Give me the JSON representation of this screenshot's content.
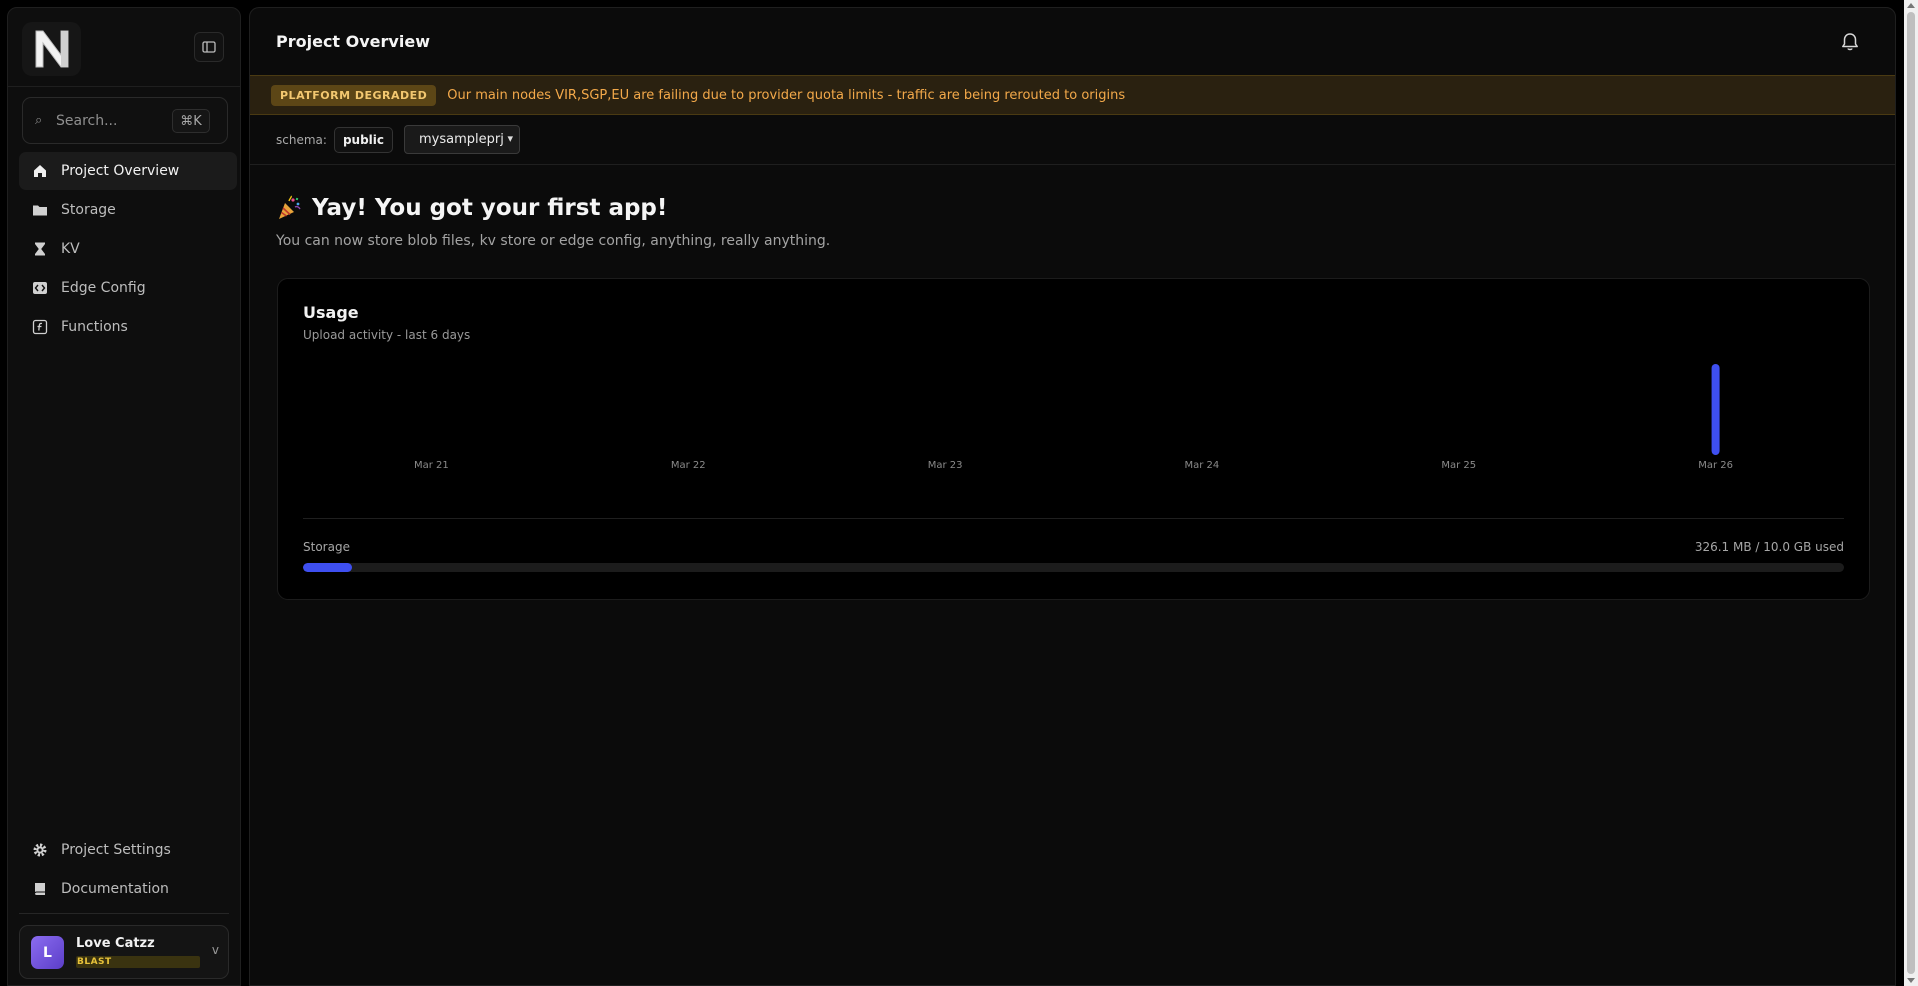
{
  "sidebar": {
    "logo_letter": "N",
    "search": {
      "placeholder": "Search...",
      "shortcut": "⌘K"
    },
    "nav": [
      {
        "label": "Project Overview",
        "icon": "home-icon",
        "active": true
      },
      {
        "label": "Storage",
        "icon": "folder-icon",
        "active": false
      },
      {
        "label": "KV",
        "icon": "hourglass-icon",
        "active": false
      },
      {
        "label": "Edge Config",
        "icon": "code-icon",
        "active": false
      },
      {
        "label": "Functions",
        "icon": "function-icon",
        "active": false
      }
    ],
    "bottom_nav": [
      {
        "label": "Project Settings",
        "icon": "gear-icon"
      },
      {
        "label": "Documentation",
        "icon": "book-icon"
      }
    ],
    "user": {
      "initial": "L",
      "name": "Love Catzz",
      "plan": "BLAST",
      "chevron": "v"
    }
  },
  "header": {
    "title": "Project Overview"
  },
  "banner": {
    "badge": "PLATFORM DEGRADED",
    "message": "Our main nodes VIR,SGP,EU are failing due to provider quota limits - traffic are being rerouted to origins"
  },
  "schema": {
    "label": "schema:",
    "value": "public",
    "project": "mysampleprj"
  },
  "hero": {
    "title": "Yay! You got your first app!",
    "subtitle": "You can now store blob files, kv store or edge config, anything, really anything."
  },
  "usage": {
    "title": "Usage",
    "subtitle": "Upload activity - last 6 days",
    "storage_label": "Storage",
    "storage_value": "326.1 MB / 10.0 GB used",
    "storage_fraction": 0.032
  },
  "chart_data": {
    "type": "bar",
    "categories": [
      "Mar 21",
      "Mar 22",
      "Mar 23",
      "Mar 24",
      "Mar 25",
      "Mar 26"
    ],
    "values": [
      0,
      0,
      0,
      0,
      0,
      1
    ],
    "color": "#3e4ff0"
  },
  "colors": {
    "accent": "#3e4ff0",
    "warning_text": "#f3a94a",
    "warning_bg": "#2a2110"
  }
}
